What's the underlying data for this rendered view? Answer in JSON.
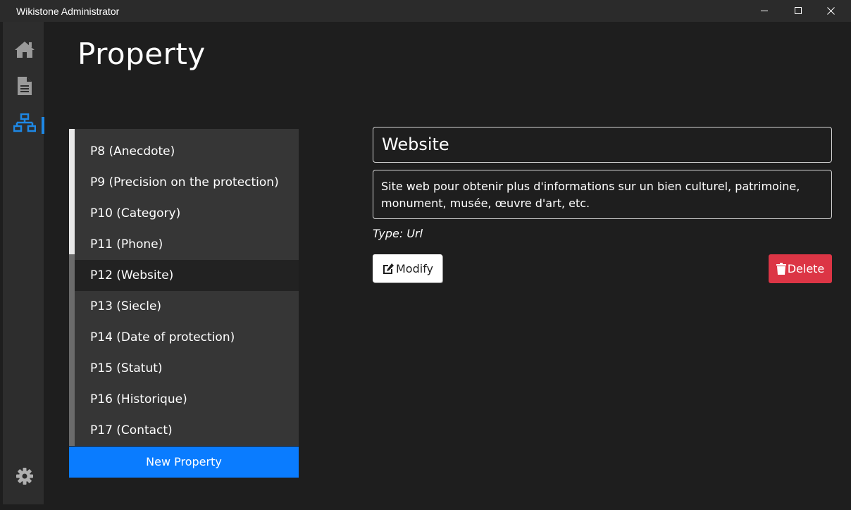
{
  "window": {
    "title": "Wikistone Administrator",
    "controls": [
      "minimize-icon",
      "maximize-icon",
      "close-icon"
    ]
  },
  "sidebar": {
    "items": [
      {
        "icon": "home-icon",
        "active": false
      },
      {
        "icon": "document-icon",
        "active": false
      },
      {
        "icon": "sitemap-icon",
        "active": true
      }
    ],
    "bottom_icon": "gear-icon",
    "accent_color": "#1e88e5"
  },
  "page": {
    "title": "Property"
  },
  "property_list": {
    "items": [
      {
        "label": "P8 (Anecdote)",
        "selected": false
      },
      {
        "label": "P9 (Precision on the protection)",
        "selected": false
      },
      {
        "label": "P10 (Category)",
        "selected": false
      },
      {
        "label": "P11 (Phone)",
        "selected": false
      },
      {
        "label": "P12 (Website)",
        "selected": true
      },
      {
        "label": "P13 (Siecle)",
        "selected": false
      },
      {
        "label": "P14 (Date of protection)",
        "selected": false
      },
      {
        "label": "P15 (Statut)",
        "selected": false
      },
      {
        "label": "P16 (Historique)",
        "selected": false
      },
      {
        "label": "P17 (Contact)",
        "selected": false
      }
    ],
    "new_button_label": "New Property",
    "new_button_color": "#0a7cff"
  },
  "detail": {
    "name": "Website",
    "description": "Site web pour obtenir plus d'informations sur un bien culturel, patrimoine, monument, musée, œuvre d'art, etc.",
    "type_text": "Type: Url",
    "modify_label": "Modify",
    "delete_label": "Delete",
    "delete_color": "#dc3545"
  }
}
